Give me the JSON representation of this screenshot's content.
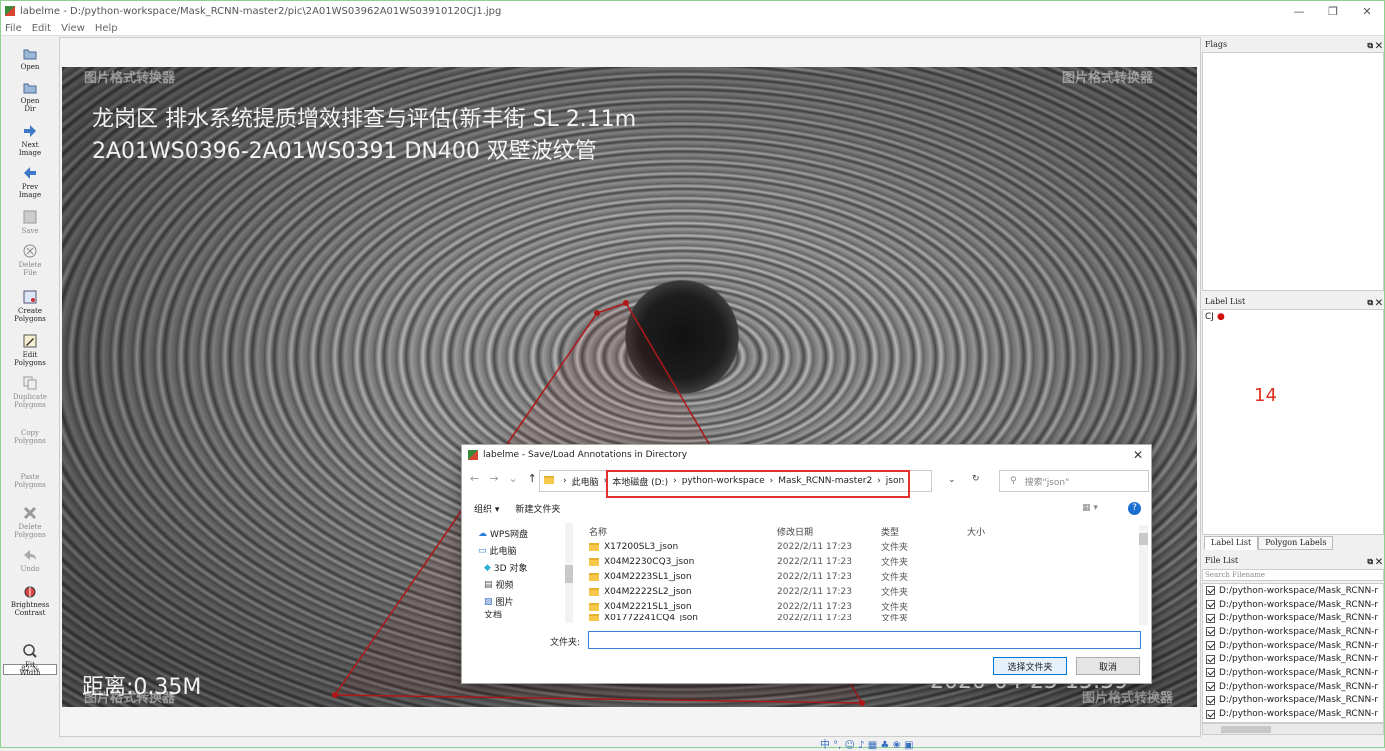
{
  "window": {
    "title": "labelme - D:/python-workspace/Mask_RCNN-master2/pic\\2A01WS03962A01WS03910120CJ1.jpg",
    "min": "—",
    "max": "❐",
    "close": "✕"
  },
  "menu": [
    "File",
    "Edit",
    "View",
    "Help"
  ],
  "toolbar": [
    {
      "label": "Open",
      "icon": "folder-icon",
      "enabled": true
    },
    {
      "label": "Open Dir",
      "icon": "folder-icon",
      "enabled": true
    },
    {
      "label": "Next Image",
      "icon": "arrow-right-icon",
      "enabled": true
    },
    {
      "label": "Prev Image",
      "icon": "arrow-left-icon",
      "enabled": true
    },
    {
      "label": "Save",
      "icon": "save-icon",
      "enabled": false
    },
    {
      "label": "Delete File",
      "icon": "delete-icon",
      "enabled": false
    },
    {
      "label": "Create Polygons",
      "icon": "create-polygon-icon",
      "enabled": true
    },
    {
      "label": "Edit Polygons",
      "icon": "edit-icon",
      "enabled": true
    },
    {
      "label": "Duplicate Polygons",
      "icon": "copy-icon",
      "enabled": false
    },
    {
      "label": "Copy Polygons",
      "icon": "copy-icon",
      "enabled": false
    },
    {
      "label": "Paste Polygons",
      "icon": "paste-icon",
      "enabled": false
    },
    {
      "label": "Delete Polygons",
      "icon": "cancel-icon",
      "enabled": false
    },
    {
      "label": "Undo",
      "icon": "undo-icon",
      "enabled": false
    },
    {
      "label": "Brightness Contrast",
      "icon": "brightness-icon",
      "enabled": true
    },
    {
      "label": "Fit Width",
      "icon": "fit-width-icon",
      "enabled": true
    }
  ],
  "zoom": "82 %",
  "overlay": {
    "line1": "龙岗区 排水系统提质增效排查与评估(新丰街  SL  2.11m",
    "line2": "2A01WS0396-2A01WS0391  DN400  双壁波纹管",
    "distance": "距离:0.35M",
    "timestamp": "2020-04-25  15:59",
    "watermark": "图片格式转换器"
  },
  "flags": {
    "title": "Flags"
  },
  "label_list": {
    "title": "Label List",
    "items": [
      {
        "label": "CJ",
        "color": "#d01010"
      }
    ],
    "annotation": "14",
    "annotation_color": "#e0301e"
  },
  "tabs": [
    "Label List",
    "Polygon Labels"
  ],
  "file_list": {
    "title": "File List",
    "search_placeholder": "Search Filename",
    "items": [
      "D:/python-workspace/Mask_RCNN-r",
      "D:/python-workspace/Mask_RCNN-r",
      "D:/python-workspace/Mask_RCNN-r",
      "D:/python-workspace/Mask_RCNN-r",
      "D:/python-workspace/Mask_RCNN-r",
      "D:/python-workspace/Mask_RCNN-r",
      "D:/python-workspace/Mask_RCNN-r",
      "D:/python-workspace/Mask_RCNN-r",
      "D:/python-workspace/Mask_RCNN-r",
      "D:/python-workspace/Mask_RCNN-r"
    ]
  },
  "dialog": {
    "title": "labelme - Save/Load Annotations in Directory",
    "path": [
      "此电脑",
      "本地磁盘 (D:)",
      "python-workspace",
      "Mask_RCNN-master2",
      "json"
    ],
    "search_placeholder": "搜索\"json\"",
    "organize": "组织 ▾",
    "new_folder": "新建文件夹",
    "tree": [
      "WPS网盘",
      "此电脑",
      "3D 对象",
      "视频",
      "图片",
      "文档"
    ],
    "columns": [
      "名称",
      "修改日期",
      "类型",
      "大小"
    ],
    "rows": [
      {
        "name": "X17200SL3_json",
        "date": "2022/2/11 17:23",
        "type": "文件夹"
      },
      {
        "name": "X04M2230CQ3_json",
        "date": "2022/2/11 17:23",
        "type": "文件夹"
      },
      {
        "name": "X04M2223SL1_json",
        "date": "2022/2/11 17:23",
        "type": "文件夹"
      },
      {
        "name": "X04M2222SL2_json",
        "date": "2022/2/11 17:23",
        "type": "文件夹"
      },
      {
        "name": "X04M2221SL1_json",
        "date": "2022/2/11 17:23",
        "type": "文件夹"
      },
      {
        "name": "X01772241CQ4_json",
        "date": "2022/2/11 17:23",
        "type": "文件夹"
      }
    ],
    "folder_label": "文件夹:",
    "folder_value": "",
    "select_button": "选择文件夹",
    "cancel_button": "取消"
  },
  "taskbar": "中 °, ☺ ♪ ▦ ♣ ❀ ▣"
}
